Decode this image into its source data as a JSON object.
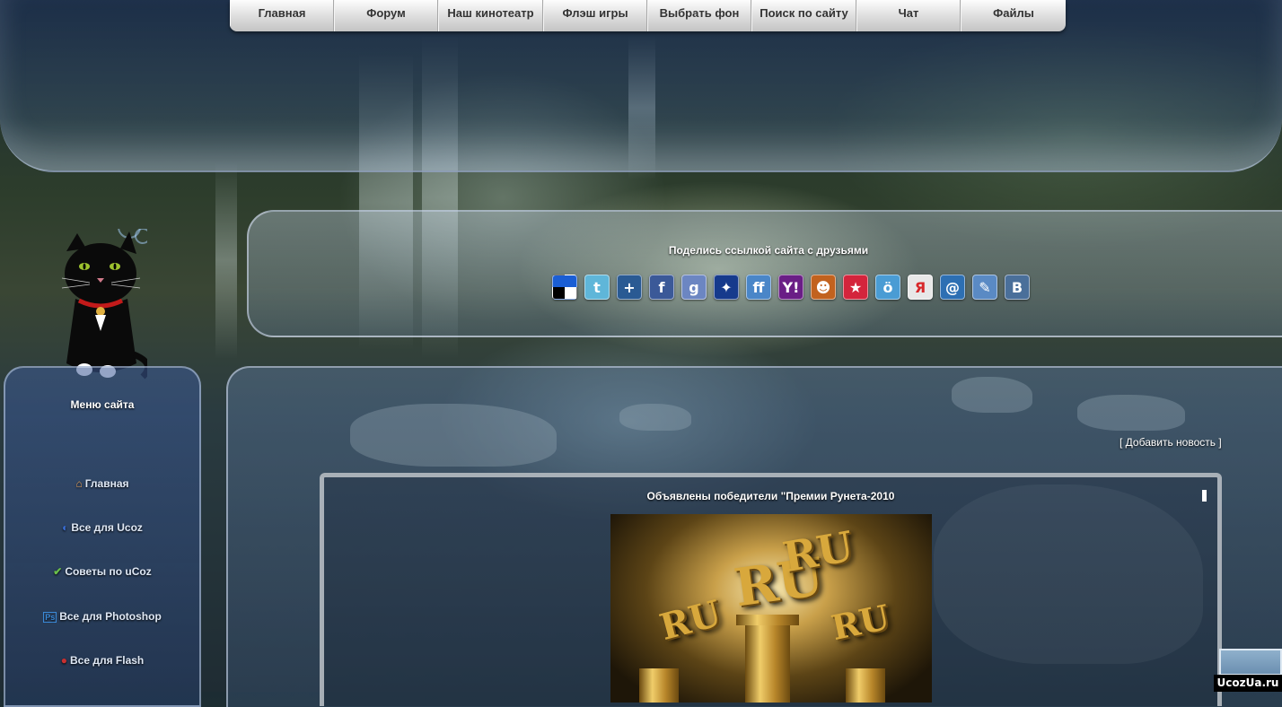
{
  "nav": {
    "items": [
      {
        "label": "Главная"
      },
      {
        "label": "Форум"
      },
      {
        "label": "Наш кинотеатр"
      },
      {
        "label": "Флэш игры"
      },
      {
        "label": "Выбрать фон"
      },
      {
        "label": "Поиск по сайту"
      },
      {
        "label": "Чат"
      },
      {
        "label": "Файлы"
      }
    ]
  },
  "share": {
    "title": "Поделись ссылкой сайта с друзьями",
    "icons": [
      {
        "name": "delicious-icon",
        "glyph": "",
        "color": "#ffffff"
      },
      {
        "name": "twitter-icon",
        "glyph": "t",
        "color": "#5fb6d9"
      },
      {
        "name": "digg-icon",
        "glyph": "+",
        "color": "#2a5a93"
      },
      {
        "name": "facebook-icon",
        "glyph": "f",
        "color": "#3b5998"
      },
      {
        "name": "google-icon",
        "glyph": "g",
        "color": "#6c86c2"
      },
      {
        "name": "myspace-icon",
        "glyph": "✦",
        "color": "#163a8c"
      },
      {
        "name": "friendfeed-icon",
        "glyph": "ff",
        "color": "#4a86c8"
      },
      {
        "name": "yahoo-icon",
        "glyph": "Y!",
        "color": "#6a1e86"
      },
      {
        "name": "mail-agent-icon",
        "glyph": "☻",
        "color": "#c2621e"
      },
      {
        "name": "moy-mir-icon",
        "glyph": "★",
        "color": "#d4243c"
      },
      {
        "name": "liveinternet-icon",
        "glyph": "ö",
        "color": "#4a9cd4"
      },
      {
        "name": "yandex-icon",
        "glyph": "Я",
        "color": "#e8e8e8"
      },
      {
        "name": "mail-ru-icon",
        "glyph": "@",
        "color": "#2d6fb3"
      },
      {
        "name": "livejournal-icon",
        "glyph": "✎",
        "color": "#5a8ac4"
      },
      {
        "name": "vkontakte-icon",
        "glyph": "B",
        "color": "#4a6f9a"
      }
    ]
  },
  "menu": {
    "title": "Меню сайта",
    "items": [
      {
        "label": "Главная",
        "icon": "⌂",
        "icon_name": "home-icon",
        "color": "#e8a25a"
      },
      {
        "label": "Все для Ucoz",
        "icon": "◐",
        "icon_name": "ucoz-icon",
        "color": "#3a6fd8"
      },
      {
        "label": "Советы по uCoz",
        "icon": "✔",
        "icon_name": "check-icon",
        "color": "#6abf4a"
      },
      {
        "label": "Все для Photoshop",
        "icon": "Ps",
        "icon_name": "photoshop-icon",
        "color": "#3b8ad8"
      },
      {
        "label": "Все для Flash",
        "icon": "●",
        "icon_name": "flash-icon",
        "color": "#c83030"
      }
    ]
  },
  "main": {
    "add_news": "[ Добавить новость ]",
    "news": {
      "title": "Объявлены победители \"Премии Рунета-2010",
      "image_words": [
        "RU",
        "RU",
        "RU",
        "RU"
      ]
    }
  },
  "watermark": "UcozUa.ru"
}
